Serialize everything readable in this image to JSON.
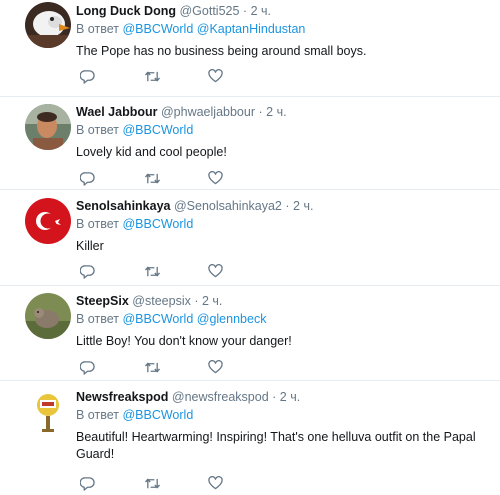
{
  "reply_prefix": "В ответ",
  "tweets": [
    {
      "name": "Long Duck Dong",
      "handle": "@Gotti525",
      "time": "2 ч.",
      "replying_to": [
        "@BBCWorld",
        "@KaptanHindustan"
      ],
      "text": "The Pope has no business being around small boys.",
      "avatar_icon": "duck-avatar"
    },
    {
      "name": "Wael Jabbour",
      "handle": "@phwaeljabbour",
      "time": "2 ч.",
      "replying_to": [
        "@BBCWorld"
      ],
      "text": "Lovely kid and cool people!",
      "avatar_icon": "person-avatar"
    },
    {
      "name": "Senolsahinkaya",
      "handle": "@Senolsahinkaya2",
      "time": "2 ч.",
      "replying_to": [
        "@BBCWorld"
      ],
      "text": "Killer",
      "avatar_icon": "red-flag-avatar"
    },
    {
      "name": "SteepSix",
      "handle": "@steepsix",
      "time": "2 ч.",
      "replying_to": [
        "@BBCWorld",
        "@glennbeck"
      ],
      "text": "Little Boy! You don't know your danger!",
      "avatar_icon": "animal-avatar"
    },
    {
      "name": "Newsfreakspod",
      "handle": "@newsfreakspod",
      "time": "2 ч.",
      "replying_to": [
        "@BBCWorld"
      ],
      "text": "Beautiful!  Heartwarming!  Inspiring!  That's one helluva outfit on the Papal Guard!",
      "avatar_icon": "microphone-avatar"
    }
  ],
  "colors": {
    "link": "#1b95e0",
    "secondary": "#657786",
    "border": "#e6ecf0",
    "icon": "#657786"
  }
}
